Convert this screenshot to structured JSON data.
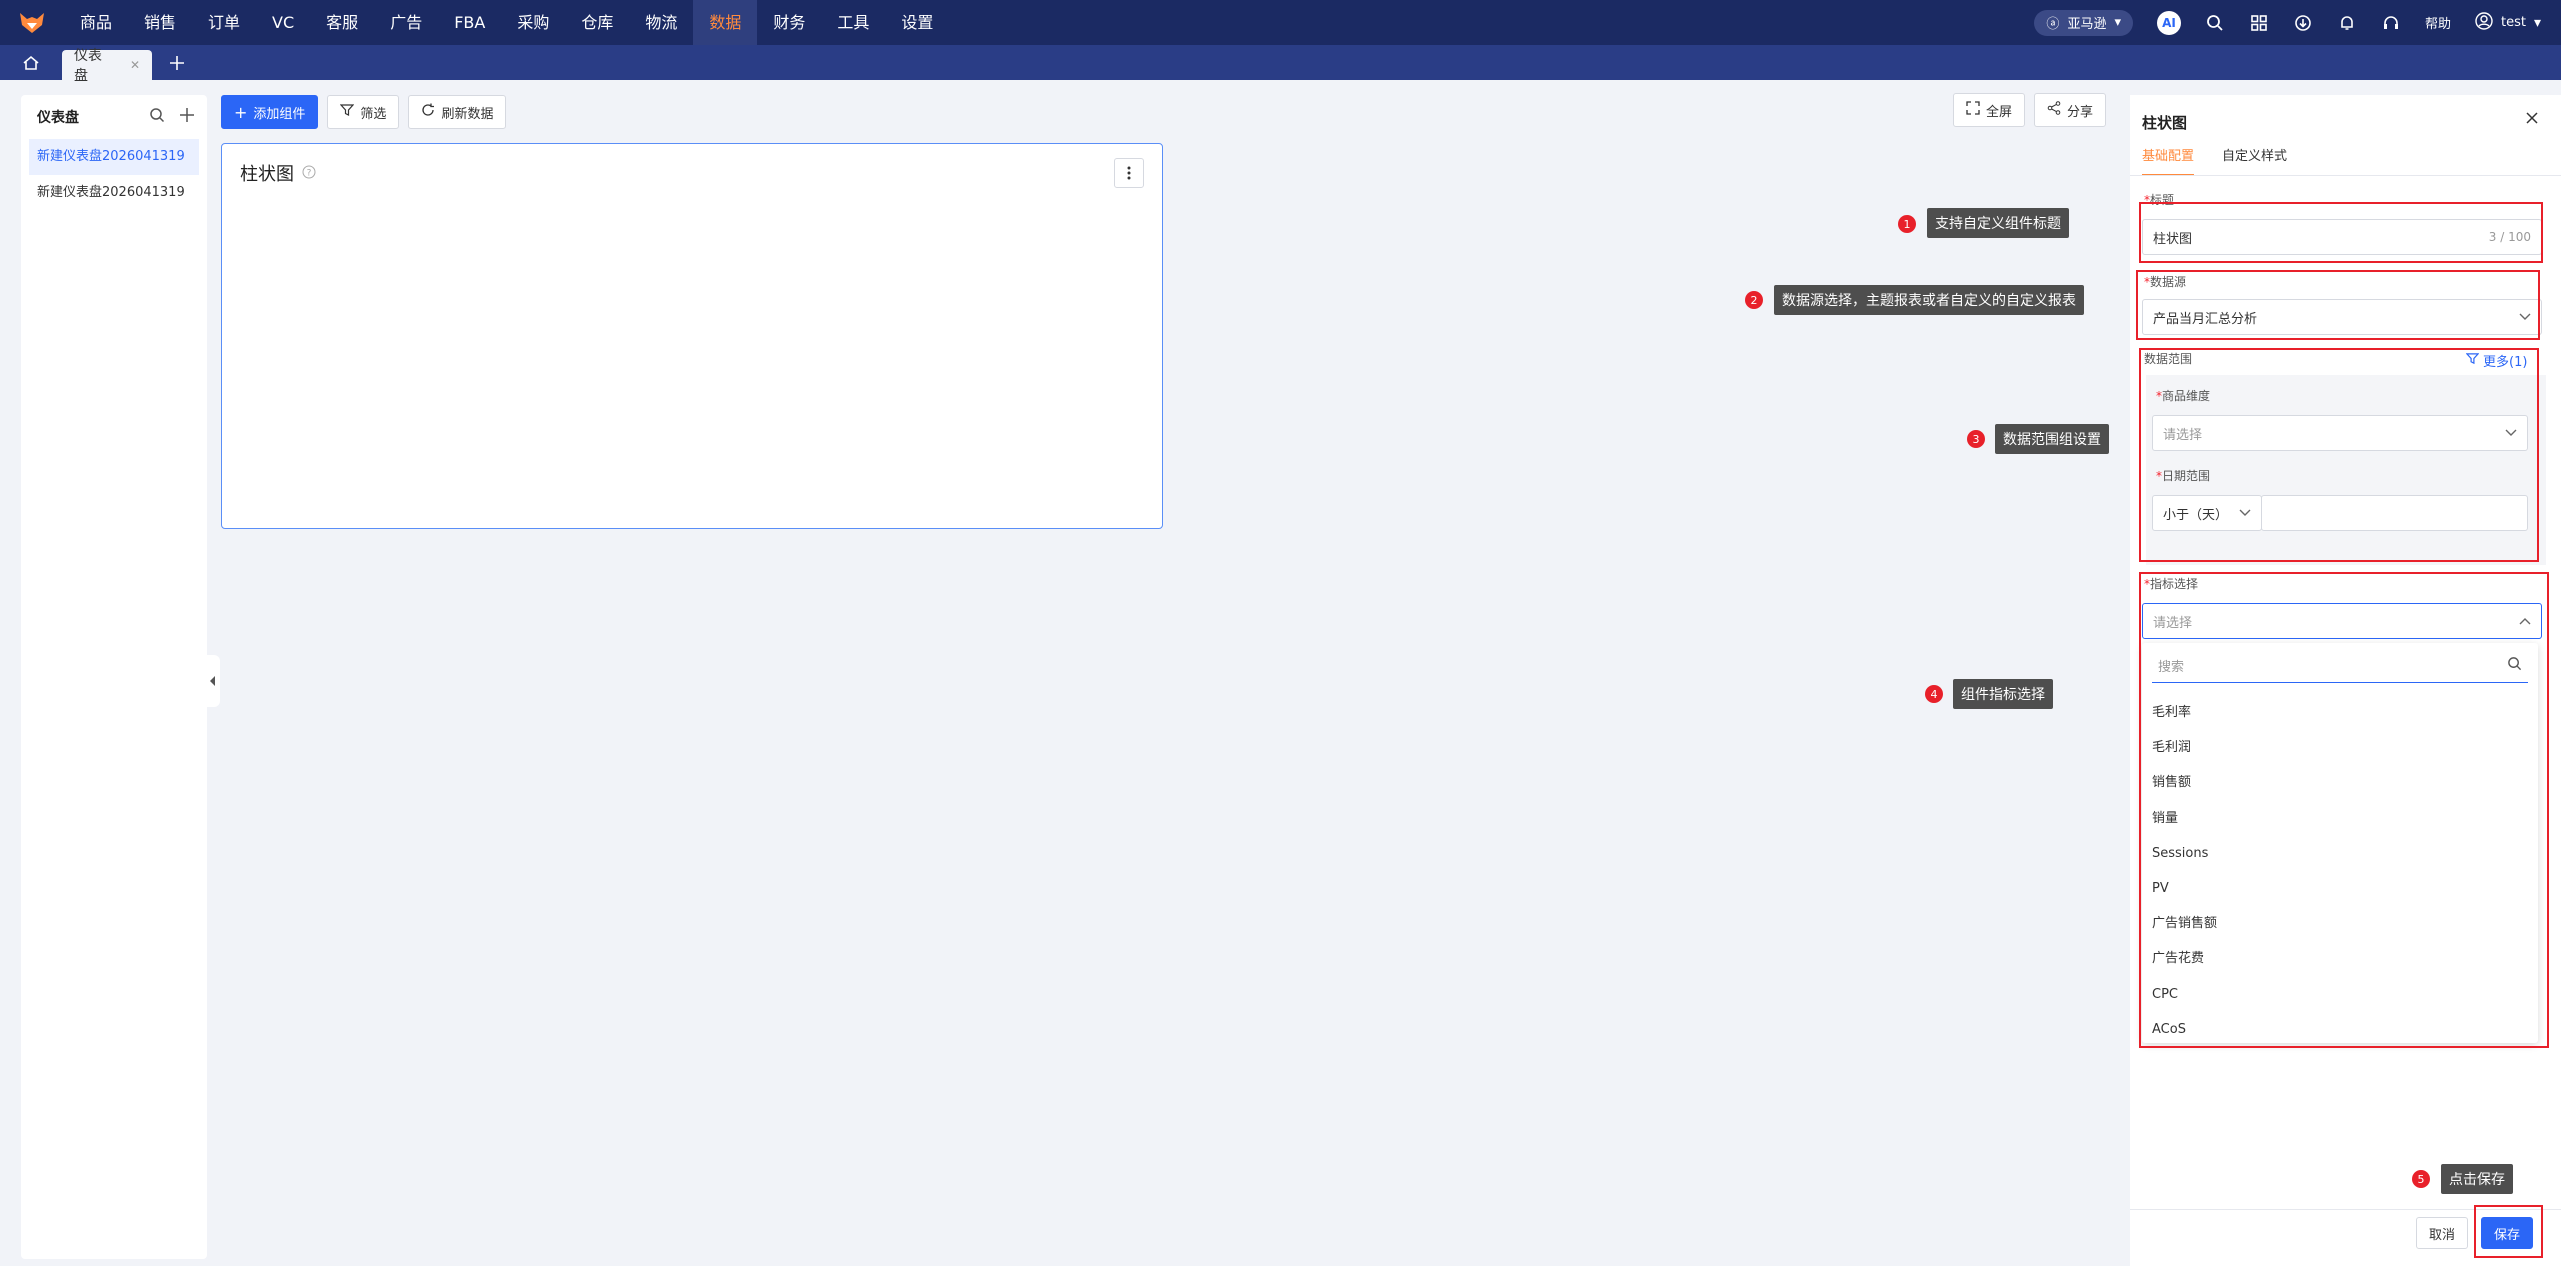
{
  "topnav": {
    "items": [
      "商品",
      "销售",
      "订单",
      "VC",
      "客服",
      "广告",
      "FBA",
      "采购",
      "仓库",
      "物流",
      "数据",
      "财务",
      "工具",
      "设置"
    ],
    "active": "数据",
    "store": "亚马逊",
    "ai": "AI",
    "help": "帮助",
    "user": "test"
  },
  "tabs": {
    "current": "仪表盘"
  },
  "left": {
    "title": "仪表盘",
    "items": [
      "新建仪表盘2026041319",
      "新建仪表盘2026041319"
    ]
  },
  "toolbar": {
    "add": "添加组件",
    "filter": "筛选",
    "refresh": "刷新数据",
    "fullscreen": "全屏",
    "share": "分享"
  },
  "card": {
    "title": "柱状图"
  },
  "panel": {
    "title": "柱状图",
    "tabs": [
      "基础配置",
      "自定义样式"
    ],
    "title_label": "标题",
    "title_value": "柱状图",
    "title_counter": "3 / 100",
    "source_label": "数据源",
    "source_value": "产品当月汇总分析",
    "scope_label": "数据范围",
    "more": "更多(1)",
    "dim_label": "商品维度",
    "dim_placeholder": "请选择",
    "date_label": "日期范围",
    "date_op": "小于（天）",
    "metric_label": "指标选择",
    "metric_placeholder": "请选择",
    "search_placeholder": "搜索",
    "options": [
      "毛利率",
      "毛利润",
      "销售额",
      "销量",
      "Sessions",
      "PV",
      "广告销售额",
      "广告花费",
      "CPC",
      "ACoS"
    ],
    "cancel": "取消",
    "save": "保存"
  },
  "annotations": [
    {
      "num": "1",
      "text": "支持自定义组件标题"
    },
    {
      "num": "2",
      "text": "数据源选择，主题报表或者自定义的自定义报表"
    },
    {
      "num": "3",
      "text": "数据范围组设置"
    },
    {
      "num": "4",
      "text": "组件指标选择"
    },
    {
      "num": "5",
      "text": "点击保存"
    }
  ],
  "colors": {
    "nav": "#1b2a63",
    "accent": "#ff8a3d",
    "primary": "#2b66f6",
    "annotation": "#e8202a"
  }
}
